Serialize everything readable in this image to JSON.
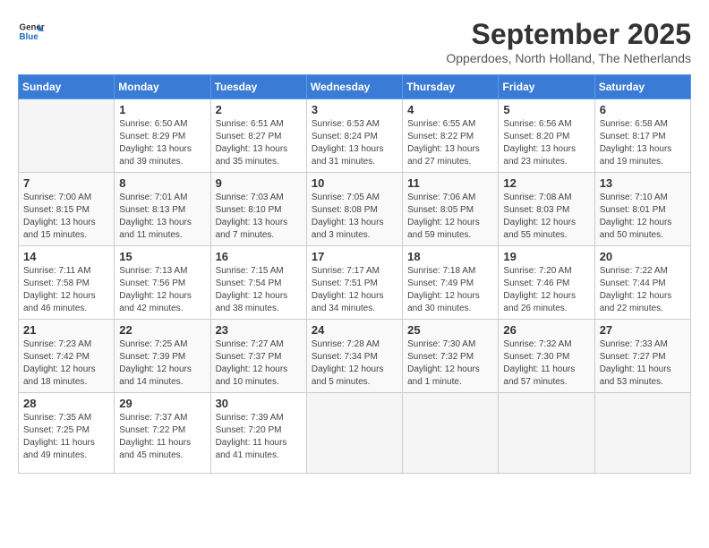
{
  "header": {
    "logo_line1": "General",
    "logo_line2": "Blue",
    "month": "September 2025",
    "location": "Opperdoes, North Holland, The Netherlands"
  },
  "days_of_week": [
    "Sunday",
    "Monday",
    "Tuesday",
    "Wednesday",
    "Thursday",
    "Friday",
    "Saturday"
  ],
  "weeks": [
    [
      {
        "num": "",
        "info": ""
      },
      {
        "num": "1",
        "info": "Sunrise: 6:50 AM\nSunset: 8:29 PM\nDaylight: 13 hours\nand 39 minutes."
      },
      {
        "num": "2",
        "info": "Sunrise: 6:51 AM\nSunset: 8:27 PM\nDaylight: 13 hours\nand 35 minutes."
      },
      {
        "num": "3",
        "info": "Sunrise: 6:53 AM\nSunset: 8:24 PM\nDaylight: 13 hours\nand 31 minutes."
      },
      {
        "num": "4",
        "info": "Sunrise: 6:55 AM\nSunset: 8:22 PM\nDaylight: 13 hours\nand 27 minutes."
      },
      {
        "num": "5",
        "info": "Sunrise: 6:56 AM\nSunset: 8:20 PM\nDaylight: 13 hours\nand 23 minutes."
      },
      {
        "num": "6",
        "info": "Sunrise: 6:58 AM\nSunset: 8:17 PM\nDaylight: 13 hours\nand 19 minutes."
      }
    ],
    [
      {
        "num": "7",
        "info": "Sunrise: 7:00 AM\nSunset: 8:15 PM\nDaylight: 13 hours\nand 15 minutes."
      },
      {
        "num": "8",
        "info": "Sunrise: 7:01 AM\nSunset: 8:13 PM\nDaylight: 13 hours\nand 11 minutes."
      },
      {
        "num": "9",
        "info": "Sunrise: 7:03 AM\nSunset: 8:10 PM\nDaylight: 13 hours\nand 7 minutes."
      },
      {
        "num": "10",
        "info": "Sunrise: 7:05 AM\nSunset: 8:08 PM\nDaylight: 13 hours\nand 3 minutes."
      },
      {
        "num": "11",
        "info": "Sunrise: 7:06 AM\nSunset: 8:05 PM\nDaylight: 12 hours\nand 59 minutes."
      },
      {
        "num": "12",
        "info": "Sunrise: 7:08 AM\nSunset: 8:03 PM\nDaylight: 12 hours\nand 55 minutes."
      },
      {
        "num": "13",
        "info": "Sunrise: 7:10 AM\nSunset: 8:01 PM\nDaylight: 12 hours\nand 50 minutes."
      }
    ],
    [
      {
        "num": "14",
        "info": "Sunrise: 7:11 AM\nSunset: 7:58 PM\nDaylight: 12 hours\nand 46 minutes."
      },
      {
        "num": "15",
        "info": "Sunrise: 7:13 AM\nSunset: 7:56 PM\nDaylight: 12 hours\nand 42 minutes."
      },
      {
        "num": "16",
        "info": "Sunrise: 7:15 AM\nSunset: 7:54 PM\nDaylight: 12 hours\nand 38 minutes."
      },
      {
        "num": "17",
        "info": "Sunrise: 7:17 AM\nSunset: 7:51 PM\nDaylight: 12 hours\nand 34 minutes."
      },
      {
        "num": "18",
        "info": "Sunrise: 7:18 AM\nSunset: 7:49 PM\nDaylight: 12 hours\nand 30 minutes."
      },
      {
        "num": "19",
        "info": "Sunrise: 7:20 AM\nSunset: 7:46 PM\nDaylight: 12 hours\nand 26 minutes."
      },
      {
        "num": "20",
        "info": "Sunrise: 7:22 AM\nSunset: 7:44 PM\nDaylight: 12 hours\nand 22 minutes."
      }
    ],
    [
      {
        "num": "21",
        "info": "Sunrise: 7:23 AM\nSunset: 7:42 PM\nDaylight: 12 hours\nand 18 minutes."
      },
      {
        "num": "22",
        "info": "Sunrise: 7:25 AM\nSunset: 7:39 PM\nDaylight: 12 hours\nand 14 minutes."
      },
      {
        "num": "23",
        "info": "Sunrise: 7:27 AM\nSunset: 7:37 PM\nDaylight: 12 hours\nand 10 minutes."
      },
      {
        "num": "24",
        "info": "Sunrise: 7:28 AM\nSunset: 7:34 PM\nDaylight: 12 hours\nand 5 minutes."
      },
      {
        "num": "25",
        "info": "Sunrise: 7:30 AM\nSunset: 7:32 PM\nDaylight: 12 hours\nand 1 minute."
      },
      {
        "num": "26",
        "info": "Sunrise: 7:32 AM\nSunset: 7:30 PM\nDaylight: 11 hours\nand 57 minutes."
      },
      {
        "num": "27",
        "info": "Sunrise: 7:33 AM\nSunset: 7:27 PM\nDaylight: 11 hours\nand 53 minutes."
      }
    ],
    [
      {
        "num": "28",
        "info": "Sunrise: 7:35 AM\nSunset: 7:25 PM\nDaylight: 11 hours\nand 49 minutes."
      },
      {
        "num": "29",
        "info": "Sunrise: 7:37 AM\nSunset: 7:22 PM\nDaylight: 11 hours\nand 45 minutes."
      },
      {
        "num": "30",
        "info": "Sunrise: 7:39 AM\nSunset: 7:20 PM\nDaylight: 11 hours\nand 41 minutes."
      },
      {
        "num": "",
        "info": ""
      },
      {
        "num": "",
        "info": ""
      },
      {
        "num": "",
        "info": ""
      },
      {
        "num": "",
        "info": ""
      }
    ]
  ]
}
